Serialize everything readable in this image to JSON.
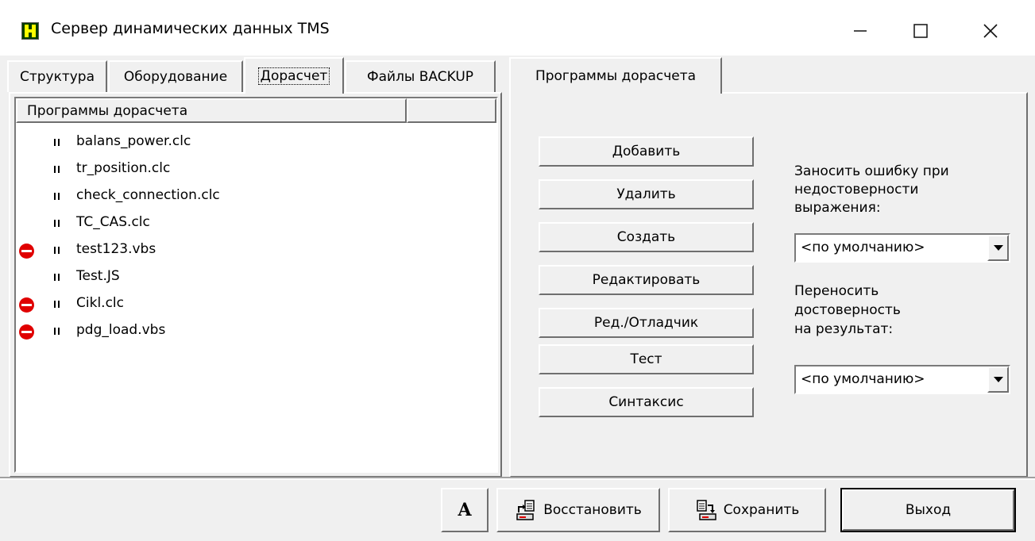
{
  "window": {
    "title": "Сервер динамических данных TMS",
    "controls": {
      "minimize": "—",
      "maximize": "☐",
      "close": "✕"
    }
  },
  "left_tabs": [
    {
      "label": "Структура",
      "active": false
    },
    {
      "label": "Оборудование",
      "active": false
    },
    {
      "label": "Дорасчет",
      "active": true
    },
    {
      "label": "Файлы BACKUP",
      "active": false
    }
  ],
  "programs_list": {
    "header": "Программы дорасчета",
    "items": [
      {
        "name": "balans_power.clc",
        "error": false
      },
      {
        "name": "tr_position.clc",
        "error": false
      },
      {
        "name": "check_connection.clc",
        "error": false
      },
      {
        "name": "TC_CAS.clc",
        "error": false
      },
      {
        "name": "test123.vbs",
        "error": true
      },
      {
        "name": "Test.JS",
        "error": false
      },
      {
        "name": "Cikl.clc",
        "error": true
      },
      {
        "name": "pdg_load.vbs",
        "error": true
      }
    ],
    "error_icon": "no-entry-icon",
    "item_icon": "grip-icon"
  },
  "right_tab": {
    "label": "Программы дорасчета"
  },
  "actions": {
    "add": "Добавить",
    "delete": "Удалить",
    "create": "Создать",
    "edit": "Редактировать",
    "debug": "Ред./Отладчик",
    "test": "Тест",
    "syntax": "Синтаксис"
  },
  "options": {
    "error_label_1": "Заносить ошибку при",
    "error_label_2": "недостоверности",
    "error_label_3": "выражения:",
    "error_value": "<по умолчанию>",
    "validity_label_1": "Переносить",
    "validity_label_2": "достоверность",
    "validity_label_3": "на результат:",
    "validity_value": "<по умолчанию>"
  },
  "bottom": {
    "font_button": "A",
    "restore": "Восстановить",
    "save": "Сохранить",
    "exit": "Выход"
  },
  "colors": {
    "error": "#e00000",
    "icon_bg": "#003c00",
    "icon_fg": "#ffff00"
  }
}
